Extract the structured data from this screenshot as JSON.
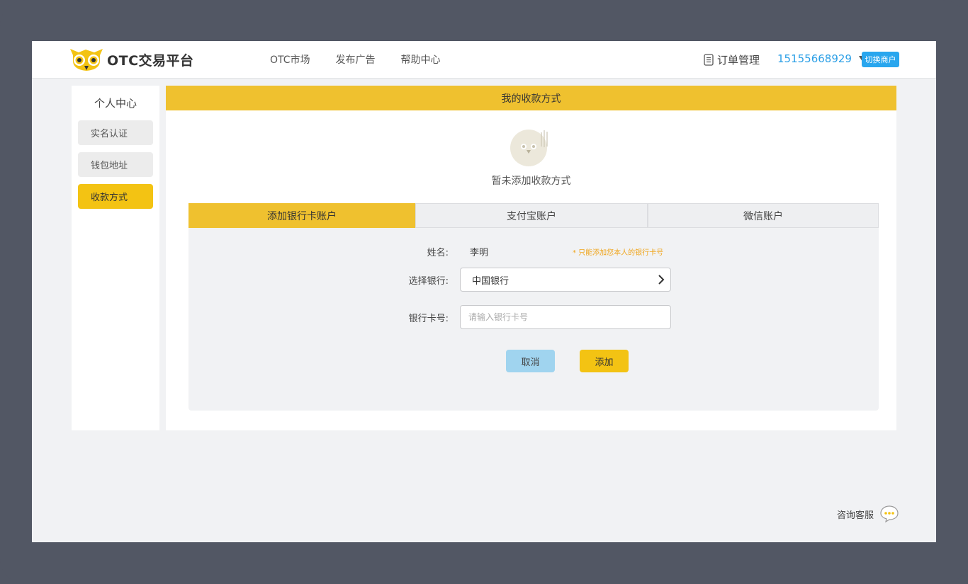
{
  "app": {
    "logo_text": "OTC交易平台",
    "colors": {
      "accent": "#efc12f",
      "link": "#2b9fe6",
      "switch": "#29a6ee",
      "cancel": "#a0d4ef"
    }
  },
  "header": {
    "nav": [
      "OTC市场",
      "发布广告",
      "帮助中心"
    ],
    "order_mgmt": "订单管理",
    "phone": "15155668929",
    "switch_label": "切换商户"
  },
  "sidebar": {
    "title": "个人中心",
    "items": [
      {
        "label": "实名认证",
        "active": false
      },
      {
        "label": "钱包地址",
        "active": false
      },
      {
        "label": "收款方式",
        "active": true
      }
    ]
  },
  "main": {
    "header": "我的收款方式",
    "empty_text": "暂未添加收款方式",
    "tabs": [
      {
        "label": "添加银行卡账户",
        "active": true
      },
      {
        "label": "支付宝账户",
        "active": false
      },
      {
        "label": "微信账户",
        "active": false
      }
    ],
    "form": {
      "name_label": "姓名:",
      "name_value": "李明",
      "hint": "* 只能添加您本人的银行卡号",
      "bank_label": "选择银行:",
      "bank_value": "中国银行",
      "card_label": "银行卡号:",
      "card_placeholder": "请输入银行卡号",
      "card_value": "",
      "cancel_label": "取消",
      "add_label": "添加"
    }
  },
  "footer": {
    "service_label": "咨询客服"
  }
}
